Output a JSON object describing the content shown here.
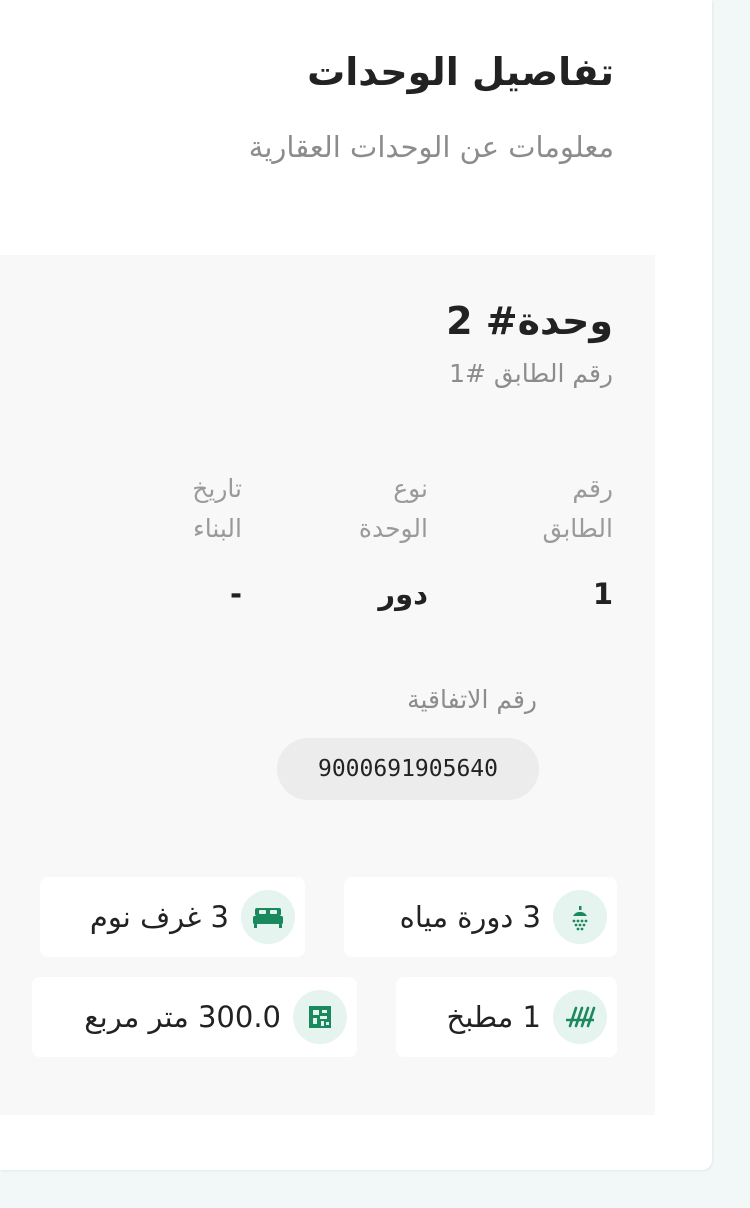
{
  "section": {
    "title": "تفاصيل الوحدات",
    "subtitle": "معلومات عن الوحدات العقارية"
  },
  "unit": {
    "title": "وحدة# 2",
    "floor_subtitle": "رقم الطابق #1",
    "columns": [
      {
        "label_line1": "رقم",
        "label_line2": "الطابق",
        "value": "1"
      },
      {
        "label_line1": "نوع",
        "label_line2": "الوحدة",
        "value": "دور"
      },
      {
        "label_line1": "تاريخ",
        "label_line2": "البناء",
        "value": "-"
      }
    ],
    "contract_label": "رقم الاتفاقية",
    "contract_number": "9000691905640",
    "features": [
      {
        "icon": "shower-icon",
        "text": "3 دورة مياه"
      },
      {
        "icon": "bed-icon",
        "text": "3 غرف نوم"
      },
      {
        "icon": "kitchen-icon",
        "text": "1 مطبخ"
      },
      {
        "icon": "area-icon",
        "text": "300.0 متر مربع"
      }
    ]
  },
  "colors": {
    "accent": "#1a8a5e",
    "icon_bg": "#e6f4ef",
    "card_bg": "#f8f8f9",
    "page_bg": "#f1f8f7"
  }
}
